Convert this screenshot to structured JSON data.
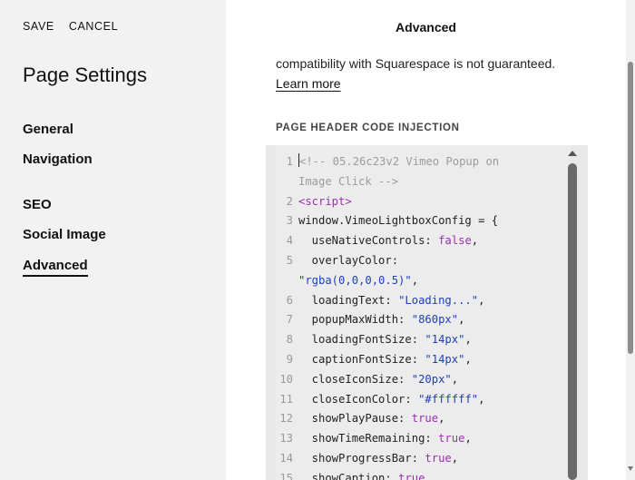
{
  "sidebar": {
    "save_label": "SAVE",
    "cancel_label": "CANCEL",
    "title": "Page Settings",
    "items": [
      {
        "label": "General"
      },
      {
        "label": "Navigation"
      },
      {
        "label": "SEO"
      },
      {
        "label": "Social Image"
      },
      {
        "label": "Advanced"
      }
    ],
    "active": "Advanced"
  },
  "panel": {
    "title": "Advanced",
    "cut_text": "compatibility with Squarespace is not guaranteed.",
    "learn_more": "Learn more",
    "section_label": "PAGE HEADER CODE INJECTION"
  },
  "editor": {
    "lines": [
      {
        "num": "1",
        "parts": [
          {
            "t": "<!-- 05.26c23v2 Vimeo Popup on",
            "c": "c"
          }
        ]
      },
      {
        "num": "",
        "parts": [
          {
            "t": "Image Click -->",
            "c": "c"
          }
        ],
        "wrap": true
      },
      {
        "num": "2",
        "parts": [
          {
            "t": "<script>",
            "c": "tag"
          }
        ]
      },
      {
        "num": "3",
        "parts": [
          {
            "t": "window.VimeoLightboxConfig = {",
            "c": "plain"
          }
        ]
      },
      {
        "num": "4",
        "parts": [
          {
            "t": "  useNativeControls: ",
            "c": "plain"
          },
          {
            "t": "false",
            "c": "kw"
          },
          {
            "t": ",",
            "c": "plain"
          }
        ]
      },
      {
        "num": "5",
        "parts": [
          {
            "t": "  overlayColor:",
            "c": "plain"
          }
        ]
      },
      {
        "num": "",
        "parts": [
          {
            "t": "\"rgba(0,0,0,0.5)\"",
            "c": "str"
          },
          {
            "t": ",",
            "c": "plain"
          }
        ],
        "wrap": true
      },
      {
        "num": "6",
        "parts": [
          {
            "t": "  loadingText: ",
            "c": "plain"
          },
          {
            "t": "\"Loading...\"",
            "c": "str"
          },
          {
            "t": ",",
            "c": "plain"
          }
        ]
      },
      {
        "num": "7",
        "parts": [
          {
            "t": "  popupMaxWidth: ",
            "c": "plain"
          },
          {
            "t": "\"860px\"",
            "c": "str"
          },
          {
            "t": ",",
            "c": "plain"
          }
        ]
      },
      {
        "num": "8",
        "parts": [
          {
            "t": "  loadingFontSize: ",
            "c": "plain"
          },
          {
            "t": "\"14px\"",
            "c": "str"
          },
          {
            "t": ",",
            "c": "plain"
          }
        ]
      },
      {
        "num": "9",
        "parts": [
          {
            "t": "  captionFontSize: ",
            "c": "plain"
          },
          {
            "t": "\"14px\"",
            "c": "str"
          },
          {
            "t": ",",
            "c": "plain"
          }
        ]
      },
      {
        "num": "10",
        "parts": [
          {
            "t": "  closeIconSize: ",
            "c": "plain"
          },
          {
            "t": "\"20px\"",
            "c": "str"
          },
          {
            "t": ",",
            "c": "plain"
          }
        ]
      },
      {
        "num": "11",
        "parts": [
          {
            "t": "  closeIconColor: ",
            "c": "plain"
          },
          {
            "t": "\"#ffffff\"",
            "c": "str"
          },
          {
            "t": ",",
            "c": "plain"
          }
        ]
      },
      {
        "num": "12",
        "parts": [
          {
            "t": "  showPlayPause: ",
            "c": "plain"
          },
          {
            "t": "true",
            "c": "kw"
          },
          {
            "t": ",",
            "c": "plain"
          }
        ]
      },
      {
        "num": "13",
        "parts": [
          {
            "t": "  showTimeRemaining: ",
            "c": "plain"
          },
          {
            "t": "true",
            "c": "kw"
          },
          {
            "t": ",",
            "c": "plain"
          }
        ]
      },
      {
        "num": "14",
        "parts": [
          {
            "t": "  showProgressBar: ",
            "c": "plain"
          },
          {
            "t": "true",
            "c": "kw"
          },
          {
            "t": ",",
            "c": "plain"
          }
        ]
      },
      {
        "num": "15",
        "parts": [
          {
            "t": "  showCaption: ",
            "c": "plain"
          },
          {
            "t": "true",
            "c": "kw"
          }
        ]
      }
    ]
  },
  "colors": {
    "sidebar_bg": "#f2f2f2",
    "editor_bg": "#ececec",
    "comment": "#9c9c9c",
    "keyword": "#9b2fb0",
    "string": "#1f3fb8"
  }
}
